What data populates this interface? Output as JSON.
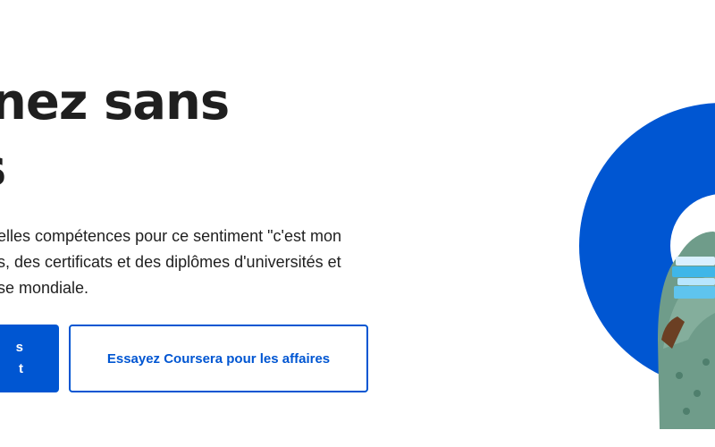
{
  "hero": {
    "headline_line1": "nez sans",
    "headline_line2": "s",
    "subtext_line1": "elles compétences pour ce sentiment \"c'est mon",
    "subtext_line2": "s, des certificats et des diplômes d'universités et",
    "subtext_line3": "se mondiale."
  },
  "buttons": {
    "primary_line1": "s",
    "primary_line2": "t",
    "secondary_label": "Essayez Coursera pour les affaires"
  },
  "colors": {
    "brand_blue": "#0056d2",
    "text_dark": "#1f1f1f"
  },
  "image": {
    "alt_icon": "student-photo-in-blue-ring"
  }
}
